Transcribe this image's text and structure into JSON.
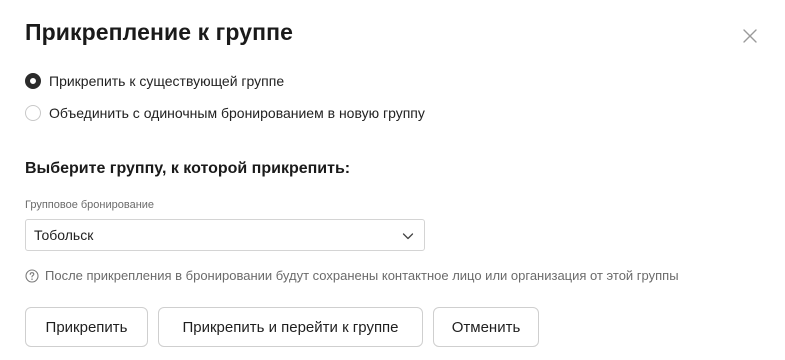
{
  "dialog": {
    "title": "Прикрепление к группе",
    "close_icon": "close-icon"
  },
  "options": [
    {
      "label": "Прикрепить к существующей группе",
      "checked": true
    },
    {
      "label": "Объединить с одиночным бронированием в новую группу",
      "checked": false
    }
  ],
  "group_section": {
    "title": "Выберите группу, к которой прикрепить:",
    "field_caption": "Групповое бронирование",
    "selected_value": "Тобольск",
    "chevron_icon": "chevron-down-icon"
  },
  "hint": {
    "icon": "question-circle-icon",
    "text": "После прикрепления в бронировании будут сохранены контактное лицо или организация от этой группы"
  },
  "buttons": {
    "attach": "Прикрепить",
    "attach_and_go": "Прикрепить и перейти к группе",
    "cancel": "Отменить"
  },
  "colors": {
    "text": "#1f1f1f",
    "muted": "#6b6b6b",
    "border": "#cfcfcf",
    "radio_checked": "#2b2b2b"
  }
}
